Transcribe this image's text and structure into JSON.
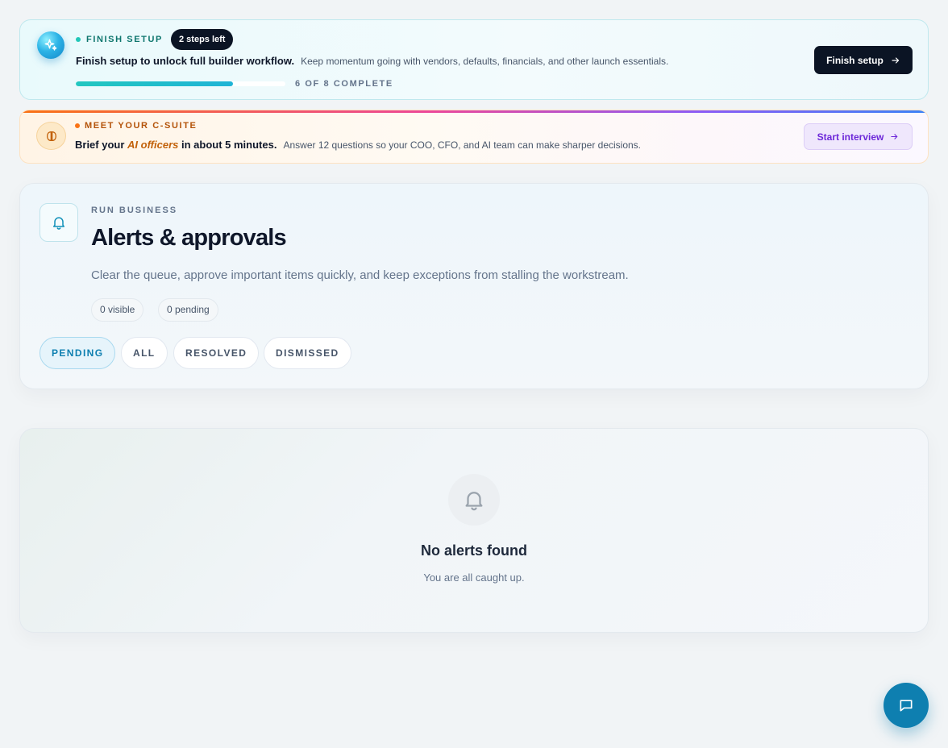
{
  "setup_banner": {
    "eyebrow": "FINISH SETUP",
    "steps_badge": "2 steps left",
    "headline": "Finish setup to unlock full builder workflow.",
    "subtext": "Keep momentum going with vendors, defaults, financials, and other launch essentials.",
    "progress_fraction": 0.75,
    "progress_label": "6 OF 8 COMPLETE",
    "button_label": "Finish setup",
    "icon": "sparkle-icon"
  },
  "csuite_banner": {
    "eyebrow": "MEET YOUR C-SUITE",
    "headline_prefix": "Brief your",
    "headline_emphasis": "AI officers",
    "headline_suffix": "in about 5 minutes.",
    "subtext": "Answer 12 questions so your COO, CFO, and AI team can make sharper decisions.",
    "button_label": "Start interview",
    "icon": "brain-icon"
  },
  "alerts_header": {
    "eyebrow": "RUN BUSINESS",
    "title": "Alerts & approvals",
    "description": "Clear the queue, approve important items quickly, and keep exceptions from stalling the workstream.",
    "visible_count": "0 visible",
    "pending_count": "0 pending",
    "filter_tabs": [
      "PENDING",
      "ALL",
      "RESOLVED",
      "DISMISSED"
    ],
    "active_tab": "PENDING",
    "icon": "bell-icon"
  },
  "empty_state": {
    "title": "No alerts found",
    "subtitle": "You are all caught up.",
    "icon": "bell-icon"
  },
  "chat": {
    "icon": "chat-icon"
  },
  "colors": {
    "primary_dark": "#0b1424",
    "accent_blue": "#0e7fb0",
    "accent_teal": "#22c7b8",
    "accent_orange": "#c2610a",
    "accent_purple": "#6d28d9"
  }
}
